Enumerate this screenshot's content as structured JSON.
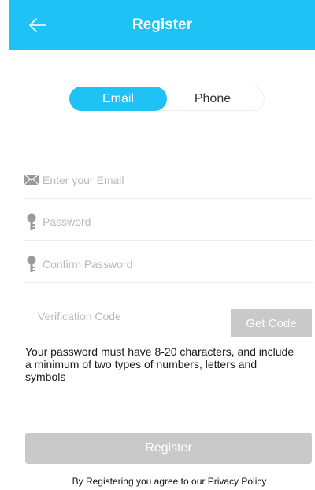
{
  "header": {
    "title": "Register"
  },
  "tabs": [
    {
      "label": "Email",
      "selected": true
    },
    {
      "label": "Phone",
      "selected": false
    }
  ],
  "form": {
    "email_placeholder": "Enter your Email",
    "password_placeholder": "Password",
    "confirm_password_placeholder": "Confirm Password",
    "verification_placeholder": "Verification Code",
    "get_code_label": "Get Code",
    "hint": "Your password must have 8-20 characters, and include a minimum of two types of numbers, letters and symbols",
    "register_label": "Register"
  },
  "footer": {
    "text": "By Registering you agree to our Privacy Policy"
  },
  "colors": {
    "header_bg": "#1ec2f5",
    "accent": "#1ec2f5",
    "disabled_button": "#c9c9c9",
    "placeholder": "#b9b9b9",
    "icon": "#9a9a9a"
  }
}
